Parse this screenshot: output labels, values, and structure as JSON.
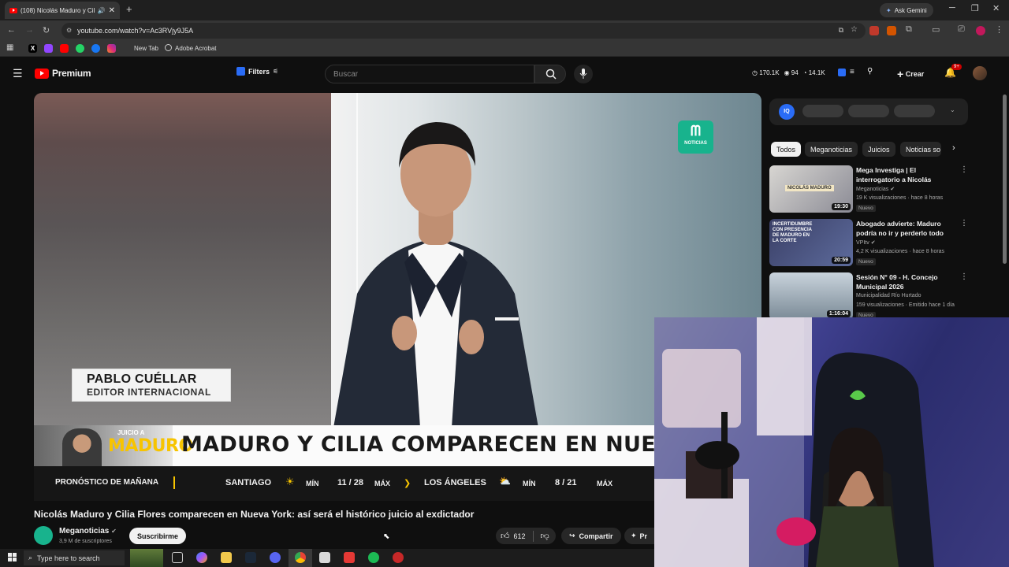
{
  "browser": {
    "tab_title": "(108) Nicolás Maduro y Cilia",
    "new_tab_glyph": "+",
    "ask_gemini": "Ask Gemini",
    "url": "youtube.com/watch?v=Ac3RVjy9J5A",
    "bookmarks": {
      "new_tab": "New Tab",
      "adobe": "Adobe Acrobat"
    }
  },
  "youtube_header": {
    "logo_text": "Premium",
    "filters_label": "Filters",
    "search_placeholder": "Buscar",
    "stats": {
      "views": "170.1K",
      "count2": "94",
      "count3": "14.1K"
    },
    "create_label": "Crear",
    "notifications_badge": "9+"
  },
  "video": {
    "nameplate_name": "PABLO CUÉLLAR",
    "nameplate_role": "EDITOR INTERNACIONAL",
    "channel_logo_text": "NOTICIAS",
    "juicio_label": "JUICIO A",
    "juicio_name": "MADURO",
    "headline": "MADURO Y CILIA COMPARECEN EN NUEVA",
    "weather": {
      "label": "PRONÓSTICO DE MAÑANA",
      "city1": "SANTIAGO",
      "min1": "MÍN",
      "range1": "11 / 28",
      "max1": "MÁX",
      "city2": "LOS ÁNGELES",
      "min2": "MÍN",
      "range2": "8 / 21",
      "max2": "MÁX"
    }
  },
  "video_info": {
    "title": "Nicolás Maduro y Cilia Flores comparecen en Nueva York: así será el histórico juicio al exdictador",
    "channel_name": "Meganoticias",
    "subscribers": "3,9 M de suscriptores",
    "subscribe_label": "Suscribirme",
    "likes": "612",
    "share_label": "Compartir",
    "more_label": "Pr"
  },
  "sidebar": {
    "iq_label": "IQ",
    "chips": [
      "Todos",
      "Meganoticias",
      "Juicios",
      "Noticias so"
    ],
    "recommendations": [
      {
        "title": "Mega Investiga | El interrogatorio a Nicolás Madur...",
        "channel": "Meganoticias",
        "meta": "19 K visualizaciones · hace 8 horas",
        "badge": "Nuevo",
        "duration": "19:30",
        "thumb_text": "NICOLÁS MADURO"
      },
      {
        "title": "Abogado advierte: Maduro podría no ir y perderlo todo",
        "channel": "VPItv",
        "meta": "4,2 K visualizaciones · hace 8 horas",
        "badge": "Nuevo",
        "duration": "20:59",
        "thumb_text": "INCERTIDUMBRE CON PRESENCIA DE MADURO EN LA CORTE"
      },
      {
        "title": "Sesión N° 09 - H. Concejo Municipal 2026",
        "channel": "Municipalidad Río Hurtado",
        "meta": "159 visualizaciones · Emitido hace 1 día",
        "badge": "Nuevo",
        "duration": "1:16:04",
        "thumb_text": ""
      }
    ]
  },
  "taskbar": {
    "search_placeholder": "Type here to search"
  },
  "colors": {
    "yt_red": "#ff0000",
    "mega_green": "#18b38d",
    "juicio_yellow": "#f7c400",
    "weather_bar": "#161616",
    "webcam_bg": "#3e3f8d"
  }
}
